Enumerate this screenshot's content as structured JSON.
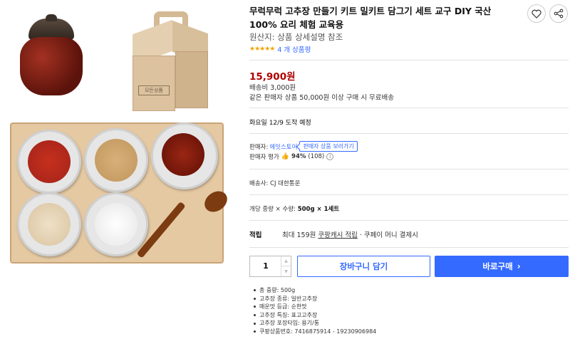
{
  "product": {
    "title": "무럭무럭 고추장 만들기 키트 밀키트 담그기 세트 교구 DIY 국산 100% 요리 체험 교육용",
    "origin": "원산지: 상품 상세설명 참조",
    "review_count": "4 개 상품평",
    "rating_stars": 5,
    "box_label": "모든상품"
  },
  "icons": {
    "wishlist": "heart-icon",
    "share": "share-icon",
    "star": "star-icon"
  },
  "colors": {
    "price": "#ae0000",
    "accent": "#346aff",
    "star": "#f5a300"
  },
  "pricing": {
    "price": "15,900원",
    "shipping_fee": "배송비 3,000원",
    "free_shipping": "같은 판매자 상품 50,000원 이상 구매 시 무료배송"
  },
  "delivery": {
    "arrival": "화요일 12/9 도착 예정"
  },
  "seller": {
    "label": "판매자: ",
    "name": "에잇스토어",
    "more_button": "판매자 상품 보러가기",
    "rating_label": "판매자 평가",
    "rating_percent": "94%",
    "rating_count": "(108)",
    "info_glyph": "i"
  },
  "shipping": {
    "carrier": "배송사: CJ 대한통운"
  },
  "option": {
    "label": "개당 중량 × 수량: ",
    "value": "500g × 1세트"
  },
  "reward": {
    "label": "적립",
    "text_prefix": "최대 159원",
    "link": "쿠팡캐시 적립",
    "text_suffix": "· 쿠페이 머니 결제시"
  },
  "purchase": {
    "quantity": "1",
    "cart_button": "장바구니 담기",
    "buy_button": "바로구매",
    "buy_chevron": "›"
  },
  "details": [
    "총 중량: 500g",
    "고추장 종류: 일반고추장",
    "매운맛 등급: 순한맛",
    "고추장 특징: 표고고추장",
    "고추장 포장타입: 용기/통",
    "쿠팡상품번호: 7416875914 - 19230906984"
  ]
}
